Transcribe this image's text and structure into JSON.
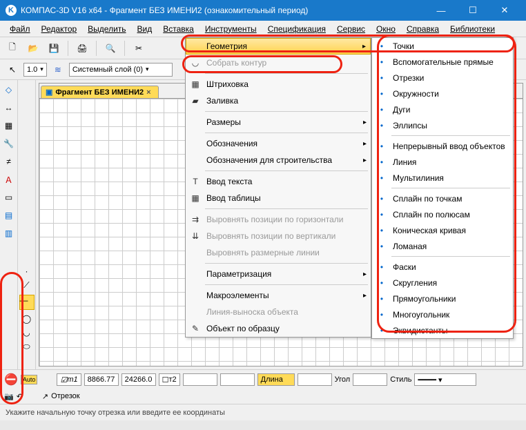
{
  "titlebar": {
    "app": "КОМПАС-3D V16  x64 - Фрагмент БЕЗ ИМЕНИ2 (ознакомительный период)"
  },
  "menubar": {
    "items": [
      "Файл",
      "Редактор",
      "Выделить",
      "Вид",
      "Вставка",
      "Инструменты",
      "Спецификация",
      "Сервис",
      "Окно",
      "Справка",
      "Библиотеки"
    ]
  },
  "row2": {
    "scale": "1.0",
    "layer": "Системный слой (0)"
  },
  "tab": {
    "name": "Фрагмент БЕЗ ИМЕНИ2"
  },
  "menu1": {
    "items": [
      {
        "label": "Геометрия",
        "hl": true,
        "sub": true
      },
      {
        "label": "Собрать контур",
        "dis": true,
        "icon": "◡"
      },
      {
        "sep": true
      },
      {
        "label": "Штриховка",
        "icon": "▦"
      },
      {
        "label": "Заливка",
        "icon": "▰"
      },
      {
        "sep": true
      },
      {
        "label": "Размеры",
        "sub": true
      },
      {
        "sep": true
      },
      {
        "label": "Обозначения",
        "sub": true
      },
      {
        "label": "Обозначения для строительства",
        "sub": true
      },
      {
        "sep": true
      },
      {
        "label": "Ввод текста",
        "icon": "T"
      },
      {
        "label": "Ввод таблицы",
        "icon": "▦"
      },
      {
        "sep": true
      },
      {
        "label": "Выровнять позиции по горизонтали",
        "dis": true,
        "icon": "⇉"
      },
      {
        "label": "Выровнять позиции по вертикали",
        "dis": true,
        "icon": "⇊"
      },
      {
        "label": "Выровнять размерные линии",
        "dis": true
      },
      {
        "sep": true
      },
      {
        "label": "Параметризация",
        "sub": true
      },
      {
        "sep": true
      },
      {
        "label": "Макроэлементы",
        "sub": true
      },
      {
        "label": "Линия-выноска объекта",
        "dis": true
      },
      {
        "label": "Объект по образцу",
        "icon": "✎"
      }
    ]
  },
  "menu2": {
    "items": [
      "Точки",
      "Вспомогательные прямые",
      "Отрезки",
      "Окружности",
      "Дуги",
      "Эллипсы",
      "",
      "Непрерывный ввод объектов",
      "Линия",
      "Мультилиния",
      "",
      "Сплайн по точкам",
      "Сплайн по полюсам",
      "Коническая кривая",
      "Ломаная",
      "",
      "Фаски",
      "Скругления",
      "Прямоугольники",
      "Многоугольник",
      "Эквидистанты"
    ]
  },
  "bottom": {
    "t1_label": "т1",
    "t1_x": "8866.77",
    "t1_y": "24266.0",
    "t2_label": "т2",
    "len_label": "Длина",
    "ang_label": "Угол",
    "style_label": "Стиль",
    "mode_label": "Отрезок"
  },
  "status": {
    "text": "Укажите начальную точку отрезка или введите ее координаты"
  }
}
